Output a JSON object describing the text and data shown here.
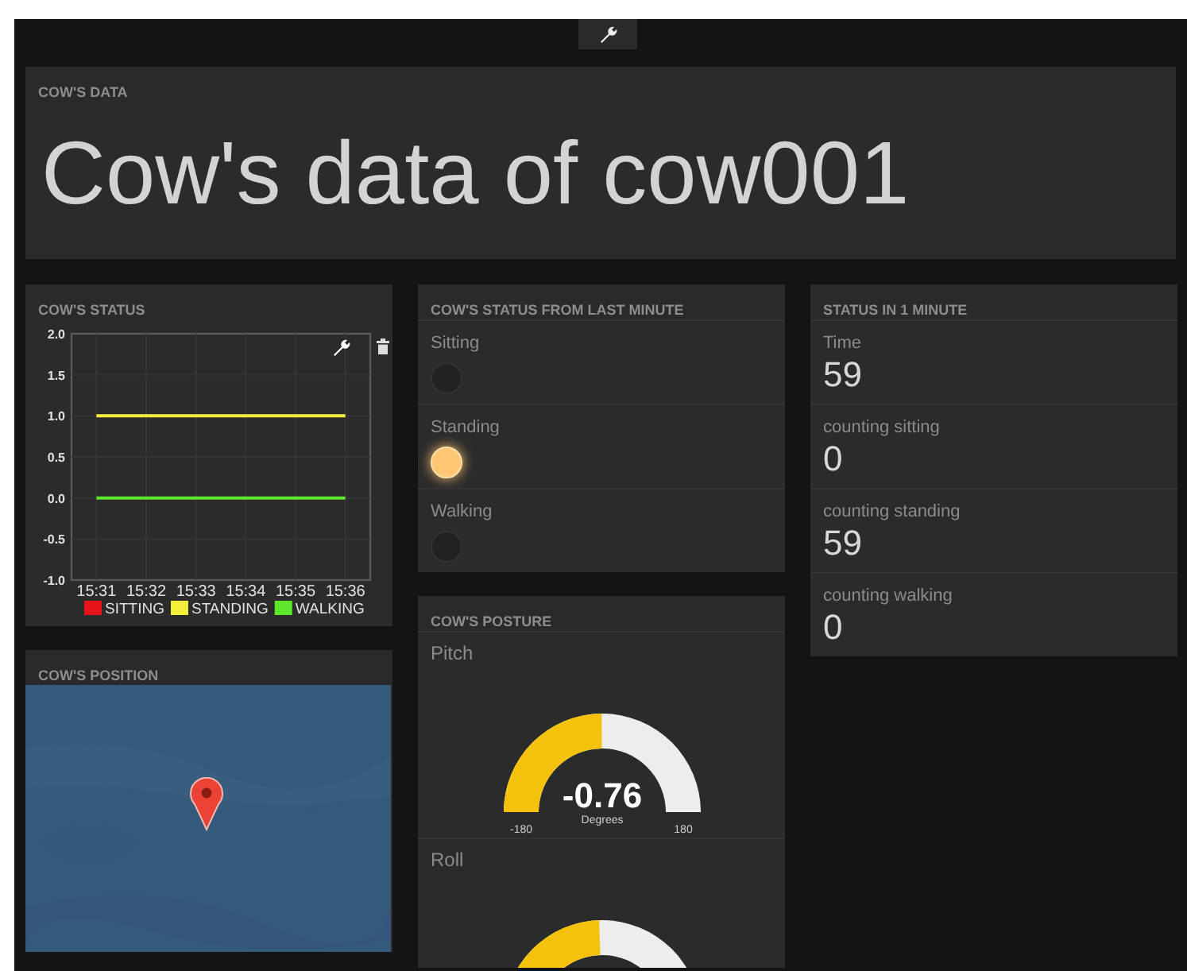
{
  "header": {
    "title": "COW'S DATA",
    "text": "Cow's data of cow001"
  },
  "status_chart": {
    "title": "COW'S STATUS",
    "chart_data": {
      "type": "line",
      "categories": [
        "15:31",
        "15:32",
        "15:33",
        "15:34",
        "15:35",
        "15:36"
      ],
      "ylim": [
        -1,
        2
      ],
      "yticks": [
        {
          "value": -1,
          "label": "-1.0"
        },
        {
          "value": -0.5,
          "label": "-0.5"
        },
        {
          "value": 0,
          "label": "0.0"
        },
        {
          "value": 0.5,
          "label": "0.5"
        },
        {
          "value": 1,
          "label": "1.0"
        },
        {
          "value": 1.5,
          "label": "1.5"
        },
        {
          "value": 2,
          "label": "2.0"
        }
      ],
      "series": [
        {
          "name": "SITTING",
          "color": "#e8141c",
          "values": [
            null,
            null,
            null,
            null,
            null,
            null
          ]
        },
        {
          "name": "STANDING",
          "color": "#f2ee3a",
          "values": [
            1,
            1,
            1,
            1,
            1,
            1
          ]
        },
        {
          "name": "WALKING",
          "color": "#5ee62a",
          "values": [
            0,
            0,
            0,
            0,
            0,
            0
          ]
        }
      ],
      "grid": true,
      "legend": true
    }
  },
  "position": {
    "title": "COW'S POSITION",
    "kind": "picture"
  },
  "last_minute": {
    "title": "COW'S STATUS FROM LAST MINUTE",
    "indicators": [
      {
        "label": "Sitting",
        "on": false
      },
      {
        "label": "Standing",
        "on": true
      },
      {
        "label": "Walking",
        "on": false
      }
    ]
  },
  "posture": {
    "title": "COW'S POSTURE",
    "gauges": [
      {
        "label": "Pitch",
        "value": "-0.76",
        "units": "Degrees",
        "min": "-180",
        "max": "180",
        "level": 0.498
      },
      {
        "label": "Roll",
        "level": 0.49
      }
    ]
  },
  "minute_status": {
    "title": "STATUS IN 1 MINUTE",
    "items": [
      {
        "label": "Time",
        "value": "59"
      },
      {
        "label": "counting sitting",
        "value": "0"
      },
      {
        "label": "counting standing",
        "value": "59"
      },
      {
        "label": "counting walking",
        "value": "0"
      }
    ]
  }
}
